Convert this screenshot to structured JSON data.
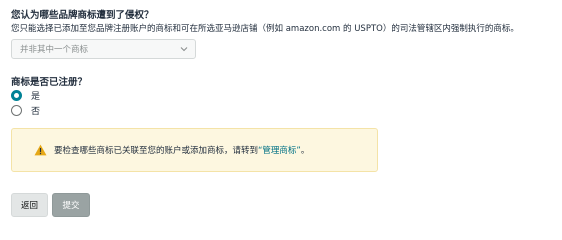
{
  "question1": {
    "title": "您认为哪些品牌商标遭到了侵权？",
    "description": "您只能选择已添加至您品牌注册账户的商标和可在所选亚马逊店铺（例如 amazon.com 的 USPTO）的司法管辖区内强制执行的商标。",
    "select_value": "并非其中一个商标",
    "select_icon": "chevron-down-icon"
  },
  "question2": {
    "title": "商标是否已注册？",
    "options": [
      {
        "label": "是",
        "checked": true
      },
      {
        "label": "否",
        "checked": false
      }
    ]
  },
  "notice": {
    "icon": "warning-icon",
    "text_before": "要检查哪些商标已关联至您的账户或添加商标，请转到",
    "link": "“管理商标”",
    "text_after": "。"
  },
  "buttons": {
    "back": "返回",
    "submit": "提交"
  },
  "colors": {
    "accent": "#008296",
    "link": "#007185",
    "notice_bg": "#fdf7e0",
    "warning": "#e6a817",
    "submit_disabled": "#9aa3a3"
  }
}
